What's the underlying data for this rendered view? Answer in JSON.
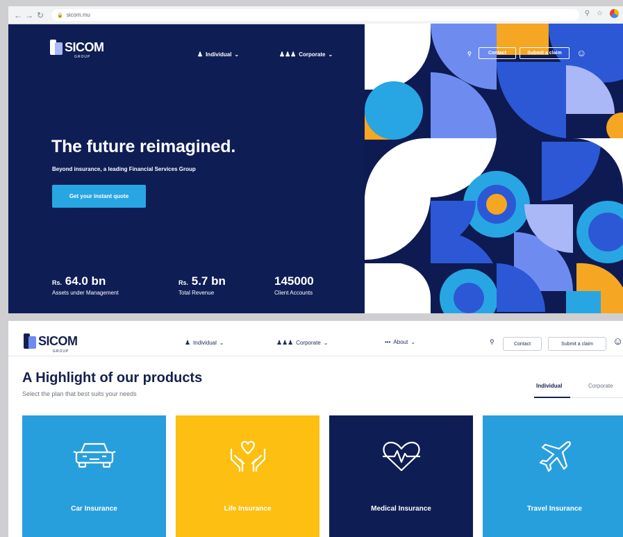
{
  "browser": {
    "url": "sicom.mu",
    "back_icon": "back-arrow-icon",
    "forward_icon": "forward-arrow-icon",
    "reload_icon": "reload-icon"
  },
  "brand": {
    "name": "SICOM",
    "sub": "GROUP"
  },
  "nav": {
    "individual": "Individual",
    "corporate": "Corporate",
    "about": "About",
    "contact": "Contact",
    "submit_claim": "Submit a claim"
  },
  "hero": {
    "title": "The future reimagined.",
    "subtitle": "Beyond insurance, a leading Financial Services Group",
    "cta": "Get your instant quote",
    "stats": [
      {
        "prefix": "Rs.",
        "value": "64.0 bn",
        "label": "Assets under Management"
      },
      {
        "prefix": "Rs.",
        "value": "5.7 bn",
        "label": "Total Revenue"
      },
      {
        "prefix": "",
        "value": "145000",
        "label": "Client Accounts"
      }
    ]
  },
  "products": {
    "title": "A Highlight of our products",
    "subtitle": "Select the plan that best suits your needs",
    "tabs": [
      "Individual",
      "Corporate"
    ],
    "active_tab": "Individual",
    "cards": [
      {
        "label": "Car Insurance",
        "icon": "car-icon",
        "color": "#289fdd"
      },
      {
        "label": "Life Insurance",
        "icon": "hands-heart-icon",
        "color": "#fcbf12"
      },
      {
        "label": "Medical Insurance",
        "icon": "heartbeat-icon",
        "color": "#0f1d55"
      },
      {
        "label": "Travel Insurance",
        "icon": "airplane-icon",
        "color": "#289fdd"
      }
    ]
  },
  "colors": {
    "navy": "#0f1d55",
    "sky": "#28a6e3",
    "yellow": "#fcbf12",
    "orange": "#f5a623",
    "royal": "#2c58d6"
  }
}
